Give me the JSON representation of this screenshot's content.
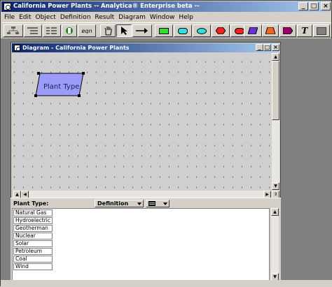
{
  "app": {
    "title": "California Power Plants -- Analytica® Enterprise beta --",
    "minimize_glyph": "_",
    "maximize_glyph": "□",
    "close_glyph": "×"
  },
  "menu": [
    "File",
    "Edit",
    "Object",
    "Definition",
    "Result",
    "Diagram",
    "Window",
    "Help"
  ],
  "toolbar": {
    "edit_label": "eqn",
    "text_tool_label": "T"
  },
  "colors": {
    "titlebar_start": "#0a246a",
    "titlebar_end": "#a6caf0",
    "node_fill": "#9a9cf8",
    "decision_green": "#33dd33",
    "chance_cyan": "#33dddd",
    "objective_red": "#ee2222",
    "module_purple": "#6633cc",
    "index_orange": "#ee6622",
    "function_magenta": "#990066"
  },
  "diagram": {
    "title": "Diagram - California Power Plants",
    "node_label": "Plant Type"
  },
  "attribute_panel": {
    "label": "Plant Type:",
    "view_dropdown": "Definition",
    "list_items": [
      "Natural Gas",
      "Hydroelectric",
      "Geotherman",
      "Nuclear",
      "Solar",
      "Petroleum",
      "Coal",
      "Wind"
    ]
  }
}
